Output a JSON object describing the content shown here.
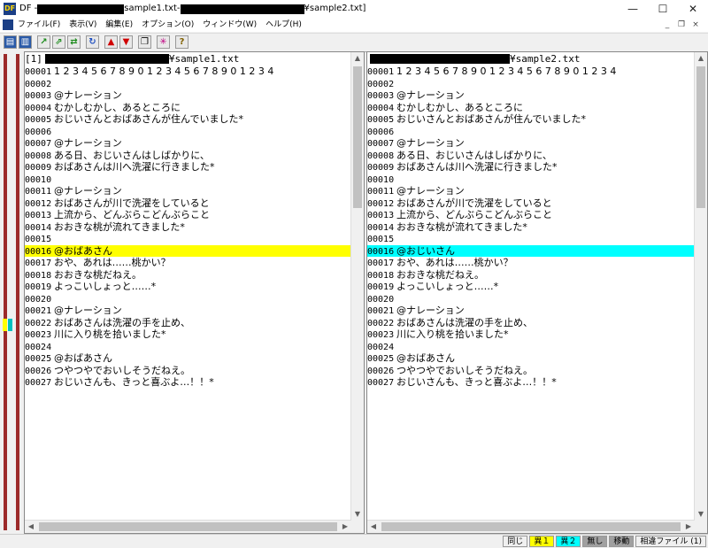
{
  "window": {
    "app_icon_text": "DF",
    "title_prefix": "DF - ",
    "title_file1": "sample1.txt",
    "title_sep": " - ",
    "title_file2": "¥sample2.txt]",
    "minimize": "—",
    "maximize": "☐",
    "close": "✕"
  },
  "menu": {
    "items": [
      "ファイル(F)",
      "表示(V)",
      "編集(E)",
      "オプション(O)",
      "ウィンドウ(W)",
      "ヘルプ(H)"
    ],
    "mdi": [
      "_",
      "❐",
      "×"
    ]
  },
  "toolbar": {
    "buttons": [
      "open-icon",
      "compare-icon",
      "prev-diff-icon",
      "next-diff-icon",
      "refresh-icon",
      "up-red-icon",
      "down-red-icon",
      "copy-icon",
      "sync-icon",
      "help-icon"
    ]
  },
  "left_pane": {
    "header_tag": "[1]",
    "header_file": "¥sample1.txt",
    "lines": [
      {
        "n": "00001",
        "t": "1 2 3 4 5 6 7 8 9 0 1 2 3 4 5 6 7 8 9 0 1 2 3 4"
      },
      {
        "n": "00002",
        "t": ""
      },
      {
        "n": "00003",
        "t": "@ナレーション"
      },
      {
        "n": "00004",
        "t": "むかしむかし、あるところに"
      },
      {
        "n": "00005",
        "t": "おじいさんとおばあさんが住んでいました*"
      },
      {
        "n": "00006",
        "t": ""
      },
      {
        "n": "00007",
        "t": "@ナレーション"
      },
      {
        "n": "00008",
        "t": "ある日、おじいさんはしばかりに、"
      },
      {
        "n": "00009",
        "t": "おばあさんは川へ洗濯に行きました*"
      },
      {
        "n": "00010",
        "t": ""
      },
      {
        "n": "00011",
        "t": "@ナレーション"
      },
      {
        "n": "00012",
        "t": "おばあさんが川で洗濯をしていると"
      },
      {
        "n": "00013",
        "t": "上流から、どんぶらこどんぶらこと"
      },
      {
        "n": "00014",
        "t": "おおきな桃が流れてきました*"
      },
      {
        "n": "00015",
        "t": ""
      },
      {
        "n": "00016",
        "t": "@おばあさん",
        "hl": "#ffff00"
      },
      {
        "n": "00017",
        "t": "おや、あれは……桃かい？"
      },
      {
        "n": "00018",
        "t": "おおきな桃だねえ。"
      },
      {
        "n": "00019",
        "t": "よっこいしょっと……*"
      },
      {
        "n": "00020",
        "t": ""
      },
      {
        "n": "00021",
        "t": "@ナレーション"
      },
      {
        "n": "00022",
        "t": "おばあさんは洗濯の手を止め、"
      },
      {
        "n": "00023",
        "t": "川に入り桃を拾いました*"
      },
      {
        "n": "00024",
        "t": ""
      },
      {
        "n": "00025",
        "t": "@おばあさん"
      },
      {
        "n": "00026",
        "t": "つやつやでおいしそうだねえ。"
      },
      {
        "n": "00027",
        "t": "おじいさんも、きっと喜ぶよ…！！*"
      }
    ]
  },
  "right_pane": {
    "header_file": "¥sample2.txt",
    "lines": [
      {
        "n": "00001",
        "t": "1 2 3 4 5 6 7 8 9 0 1 2 3 4 5 6 7 8 9 0 1 2 3 4"
      },
      {
        "n": "00002",
        "t": ""
      },
      {
        "n": "00003",
        "t": "@ナレーション"
      },
      {
        "n": "00004",
        "t": "むかしむかし、あるところに"
      },
      {
        "n": "00005",
        "t": "おじいさんとおばあさんが住んでいました*"
      },
      {
        "n": "00006",
        "t": ""
      },
      {
        "n": "00007",
        "t": "@ナレーション"
      },
      {
        "n": "00008",
        "t": "ある日、おじいさんはしばかりに、"
      },
      {
        "n": "00009",
        "t": "おばあさんは川へ洗濯に行きました*"
      },
      {
        "n": "00010",
        "t": ""
      },
      {
        "n": "00011",
        "t": "@ナレーション"
      },
      {
        "n": "00012",
        "t": "おばあさんが川で洗濯をしていると"
      },
      {
        "n": "00013",
        "t": "上流から、どんぶらこどんぶらこと"
      },
      {
        "n": "00014",
        "t": "おおきな桃が流れてきました*"
      },
      {
        "n": "00015",
        "t": ""
      },
      {
        "n": "00016",
        "t": "@おじいさん",
        "hl": "#00ffff"
      },
      {
        "n": "00017",
        "t": "おや、あれは……桃かい？"
      },
      {
        "n": "00018",
        "t": "おおきな桃だねえ。"
      },
      {
        "n": "00019",
        "t": "よっこいしょっと……*"
      },
      {
        "n": "00020",
        "t": ""
      },
      {
        "n": "00021",
        "t": "@ナレーション"
      },
      {
        "n": "00022",
        "t": "おばあさんは洗濯の手を止め、"
      },
      {
        "n": "00023",
        "t": "川に入り桃を拾いました*"
      },
      {
        "n": "00024",
        "t": ""
      },
      {
        "n": "00025",
        "t": "@おばあさん"
      },
      {
        "n": "00026",
        "t": "つやつやでおいしそうだねえ。"
      },
      {
        "n": "00027",
        "t": "おじいさんも、きっと喜ぶよ…！！*"
      }
    ]
  },
  "statusbar": {
    "cells": [
      {
        "label": "同じ",
        "bg": "#f0f0f0"
      },
      {
        "label": "異１",
        "bg": "#ffff00"
      },
      {
        "label": "異２",
        "bg": "#00ffff"
      },
      {
        "label": "無し",
        "bg": "#a0a0a0"
      },
      {
        "label": "移動",
        "bg": "#a0a0a0"
      },
      {
        "label": "相違ファイル (1)",
        "bg": "#f0f0f0"
      }
    ]
  },
  "colors": {
    "diff1": "#ffff00",
    "diff2": "#00ffff",
    "overview_line": "#9c2a2a"
  }
}
